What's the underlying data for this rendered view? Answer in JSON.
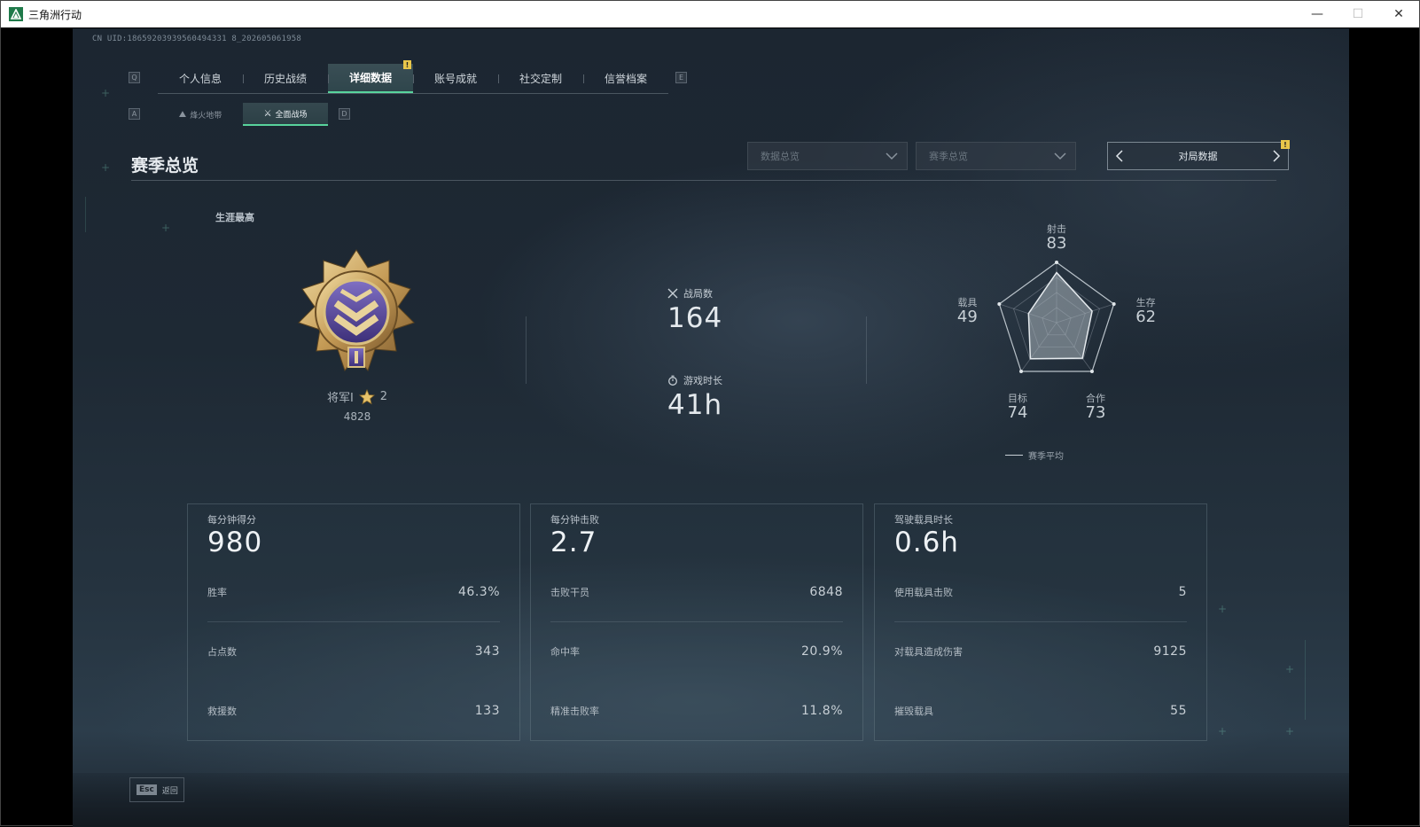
{
  "window": {
    "title": "三角洲行动",
    "minimize": "—",
    "maximize": "☐",
    "close": "✕"
  },
  "uid": "CN UID:18659203939560494331 8_202605061958",
  "nav": {
    "left_key": "Q",
    "right_key": "E",
    "tabs": [
      {
        "label": "个人信息"
      },
      {
        "label": "历史战绩"
      },
      {
        "label": "详细数据",
        "active": true,
        "badge": "!"
      },
      {
        "label": "账号成就"
      },
      {
        "label": "社交定制"
      },
      {
        "label": "信誉档案"
      }
    ]
  },
  "subnav": {
    "left_key": "A",
    "right_key": "D",
    "tabs": [
      {
        "label": "烽火地带",
        "icon": "beacon-icon"
      },
      {
        "label": "全面战场",
        "icon": "battlefield-icon",
        "active": true
      }
    ]
  },
  "section": {
    "title": "赛季总览"
  },
  "filters": {
    "data_overview": "数据总览",
    "season_overview": "赛季总览",
    "switcher_label": "对局数据",
    "switcher_badge": "!"
  },
  "career": {
    "label": "生涯最高",
    "rank_name": "将军Ⅰ",
    "stars": "2",
    "score": "4828",
    "emblem_icon": "general-rank-emblem-icon"
  },
  "summary": {
    "matches_label": "战局数",
    "matches_value": "164",
    "playtime_label": "游戏时长",
    "playtime_value": "41h"
  },
  "radar": {
    "axes": [
      {
        "label": "射击",
        "value": 83
      },
      {
        "label": "生存",
        "value": 62
      },
      {
        "label": "合作",
        "value": 73
      },
      {
        "label": "目标",
        "value": 74
      },
      {
        "label": "载具",
        "value": 49
      }
    ],
    "legend": "赛季平均"
  },
  "cards": [
    {
      "head_label": "每分钟得分",
      "head_value": "980",
      "rows": [
        {
          "k": "胜率",
          "v": "46.3%"
        },
        {
          "k": "占点数",
          "v": "343"
        },
        {
          "k": "救援数",
          "v": "133"
        }
      ]
    },
    {
      "head_label": "每分钟击败",
      "head_value": "2.7",
      "rows": [
        {
          "k": "击败干员",
          "v": "6848"
        },
        {
          "k": "命中率",
          "v": "20.9%"
        },
        {
          "k": "精准击败率",
          "v": "11.8%"
        }
      ]
    },
    {
      "head_label": "驾驶载具时长",
      "head_value": "0.6h",
      "rows": [
        {
          "k": "使用载具击败",
          "v": "5"
        },
        {
          "k": "对载具造成伤害",
          "v": "9125"
        },
        {
          "k": "摧毁载具",
          "v": "55"
        }
      ]
    }
  ],
  "footer": {
    "esc_key": "Esc",
    "esc_label": "返回"
  }
}
